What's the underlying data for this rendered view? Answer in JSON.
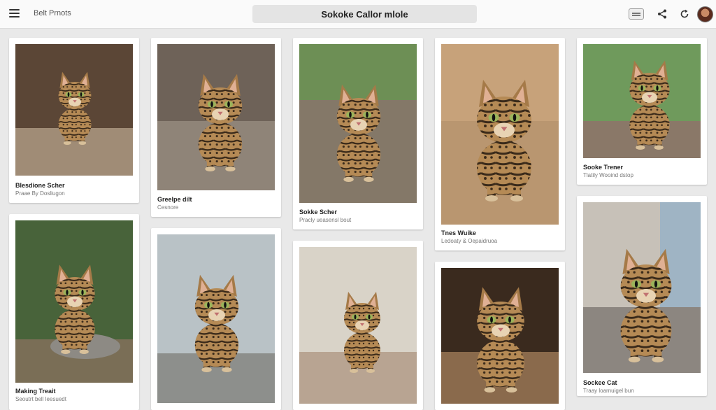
{
  "header": {
    "app_title": "Belt Prnots",
    "search_text": "Sokoke Callor mlole",
    "avatar_label": "User avatar"
  },
  "cards": [
    {
      "title": "Blesdione Scher",
      "subtitle": "Praae By Dosliugon",
      "bg": "#5b4636",
      "floor": "#a08c76"
    },
    {
      "title": "Greelpe dilt",
      "subtitle": "Cesnore",
      "bg": "#6e6258",
      "floor": "#8f8478"
    },
    {
      "title": "Sokke Scher",
      "subtitle": "Pracly ueasensl bout",
      "bg": "#6d8f55",
      "floor": "#847868"
    },
    {
      "title": "Tnes Wuike",
      "subtitle": "Ledoaty & Oepaidruoa",
      "bg": "#c7a27a",
      "floor": "#b99670"
    },
    {
      "title": "Sooke Trener",
      "subtitle": "Tlatily Wooind dstop",
      "bg": "#6f9a5c",
      "floor": "#8a7868"
    },
    {
      "title": "Making Treait",
      "subtitle": "Seoutrt bell leesuedt",
      "bg": "#48633a",
      "floor": "#7a6e56"
    },
    {
      "title": "",
      "subtitle": "",
      "bg": "#b9c2c6",
      "floor": "#8d8f8c"
    },
    {
      "title": "",
      "subtitle": "",
      "bg": "#d9d3c8",
      "floor": "#b8a492"
    },
    {
      "title": "",
      "subtitle": "",
      "bg": "#3a2a1e",
      "floor": "#8a6a4c"
    },
    {
      "title": "Sockee Cat",
      "subtitle": "Traay loarnuigel bun",
      "bg": "#c7c1b8",
      "floor": "#8c8680"
    }
  ]
}
